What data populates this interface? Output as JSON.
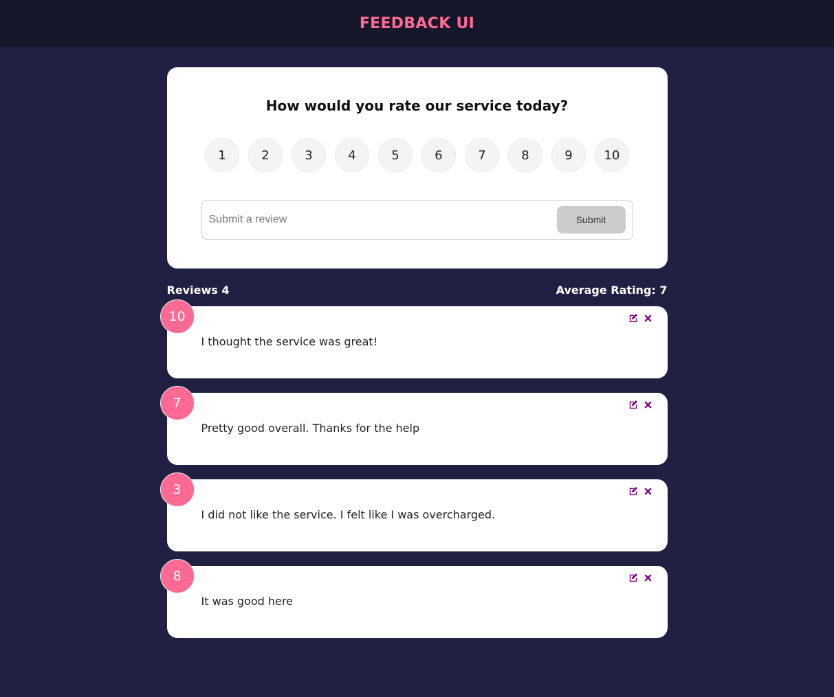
{
  "header": {
    "title": "FEEDBACK UI"
  },
  "rating_card": {
    "question": "How would you rate our service today?",
    "options": [
      "1",
      "2",
      "3",
      "4",
      "5",
      "6",
      "7",
      "8",
      "9",
      "10"
    ],
    "input_placeholder": "Submit a review",
    "submit_label": "Submit"
  },
  "stats": {
    "reviews_label": "Reviews 4",
    "average_label": "Average Rating: 7"
  },
  "reviews": [
    {
      "rating": "10",
      "text": "I thought the service was great!"
    },
    {
      "rating": "7",
      "text": "Pretty good overall. Thanks for the help"
    },
    {
      "rating": "3",
      "text": "I did not like the service. I felt like I was overcharged."
    },
    {
      "rating": "8",
      "text": "It was good here"
    }
  ],
  "colors": {
    "accent": "#ff6a95",
    "background": "#202142",
    "header_bg": "#151629",
    "icon": "#800080"
  },
  "icons": {
    "edit": "edit-icon",
    "delete": "close-icon"
  }
}
